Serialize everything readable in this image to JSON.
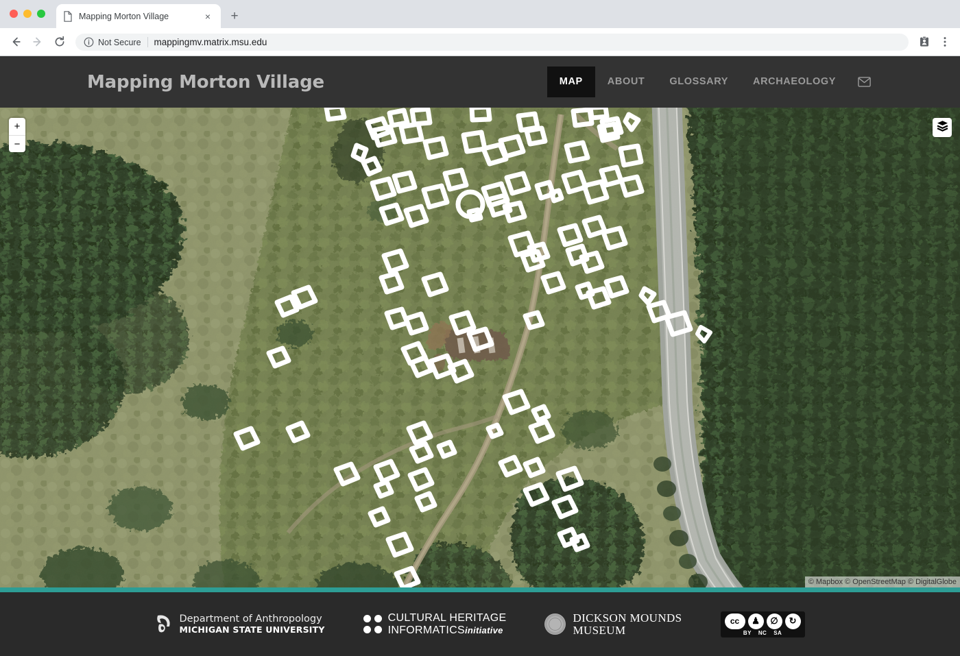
{
  "browser": {
    "tab_title": "Mapping Morton Village",
    "tab_close_label": "×",
    "new_tab_label": "+",
    "back_label": "←",
    "forward_label": "→",
    "reload_label": "↻",
    "security_label": "Not Secure",
    "url": "mappingmv.matrix.msu.edu"
  },
  "site": {
    "title": "Mapping Morton Village",
    "nav": [
      {
        "label": "MAP",
        "active": true
      },
      {
        "label": "ABOUT",
        "active": false
      },
      {
        "label": "GLOSSARY",
        "active": false
      },
      {
        "label": "ARCHAEOLOGY",
        "active": false
      }
    ],
    "mail_icon": "envelope-icon"
  },
  "map": {
    "zoom_in_label": "+",
    "zoom_out_label": "−",
    "layers_icon": "layers-icon",
    "attribution": "© Mapbox © OpenStreetMap © DigitalGlobe",
    "colors": {
      "field": "#8d9368",
      "forest_dark": "#2f4227",
      "forest_mid": "#3d5530",
      "road": "#a9aca7",
      "path": "#a89c7e",
      "excavation": "#6d5a46",
      "feature_outline": "#ffffff"
    }
  },
  "footer": {
    "accent_color": "#2d9d95",
    "background_color": "#2a2a2a",
    "logos": [
      {
        "name": "msu-anthropology-logo",
        "line1": "Department of Anthropology",
        "line2": "MICHIGAN STATE UNIVERSITY"
      },
      {
        "name": "cultural-heritage-informatics-logo",
        "line1": "CULTURAL HERITAGE",
        "line2": "INFORMATICS",
        "line2_suffix": "initiative"
      },
      {
        "name": "dickson-mounds-museum-logo",
        "line1": "DICKSON MOUNDS",
        "line2": "MUSEUM"
      },
      {
        "name": "creative-commons-badge",
        "marks": [
          "cc",
          "by",
          "nc",
          "sa"
        ],
        "labels": [
          "BY",
          "NC",
          "SA"
        ]
      }
    ]
  }
}
